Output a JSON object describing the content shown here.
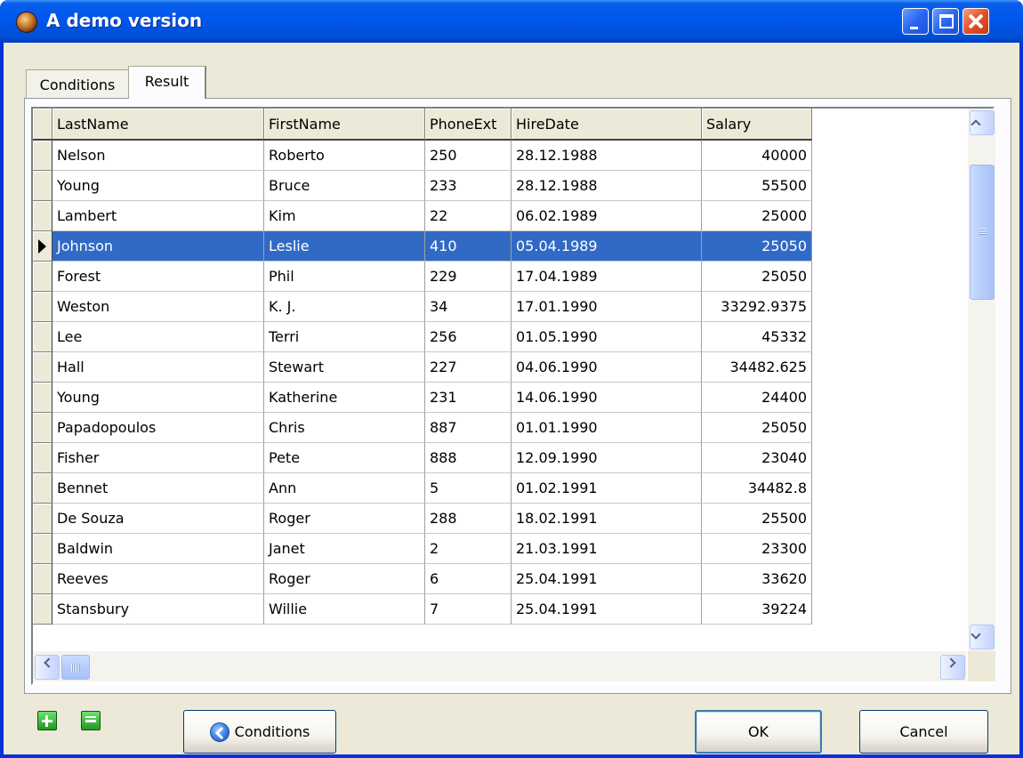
{
  "window": {
    "title": "A demo version"
  },
  "tabs": [
    {
      "label": "Conditions",
      "active": false
    },
    {
      "label": "Result",
      "active": true
    }
  ],
  "grid": {
    "columns": [
      "LastName",
      "FirstName",
      "PhoneExt",
      "HireDate",
      "Salary"
    ],
    "selected_row": 3,
    "rows": [
      [
        "Nelson",
        "Roberto",
        "250",
        "28.12.1988",
        "40000"
      ],
      [
        "Young",
        "Bruce",
        "233",
        "28.12.1988",
        "55500"
      ],
      [
        "Lambert",
        "Kim",
        "22",
        "06.02.1989",
        "25000"
      ],
      [
        "Johnson",
        "Leslie",
        "410",
        "05.04.1989",
        "25050"
      ],
      [
        "Forest",
        "Phil",
        "229",
        "17.04.1989",
        "25050"
      ],
      [
        "Weston",
        "K. J.",
        "34",
        "17.01.1990",
        "33292.9375"
      ],
      [
        "Lee",
        "Terri",
        "256",
        "01.05.1990",
        "45332"
      ],
      [
        "Hall",
        "Stewart",
        "227",
        "04.06.1990",
        "34482.625"
      ],
      [
        "Young",
        "Katherine",
        "231",
        "14.06.1990",
        "24400"
      ],
      [
        "Papadopoulos",
        "Chris",
        "887",
        "01.01.1990",
        "25050"
      ],
      [
        "Fisher",
        "Pete",
        "888",
        "12.09.1990",
        "23040"
      ],
      [
        "Bennet",
        "Ann",
        "5",
        "01.02.1991",
        "34482.8"
      ],
      [
        "De Souza",
        "Roger",
        "288",
        "18.02.1991",
        "25500"
      ],
      [
        "Baldwin",
        "Janet",
        "2",
        "21.03.1991",
        "23300"
      ],
      [
        "Reeves",
        "Roger",
        "6",
        "25.04.1991",
        "33620"
      ],
      [
        "Stansbury",
        "Willie",
        "7",
        "25.04.1991",
        "39224"
      ]
    ]
  },
  "buttons": {
    "conditions": "Conditions",
    "ok": "OK",
    "cancel": "Cancel"
  },
  "colors": {
    "selection": "#316ac5",
    "titlebar": "#0054e3",
    "dialog_bg": "#ece9d8"
  }
}
